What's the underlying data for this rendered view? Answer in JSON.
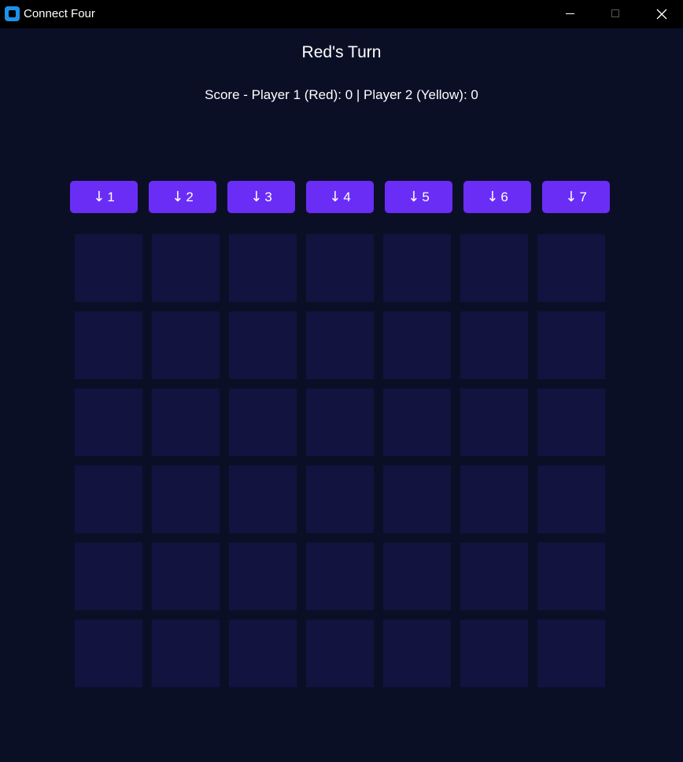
{
  "window": {
    "title": "Connect Four",
    "icon": "app-icon",
    "controls": [
      "minimize-icon",
      "maximize-icon",
      "close-icon"
    ]
  },
  "game": {
    "turn_text": "Red's Turn",
    "score_text": "Score - Player 1 (Red): 0 | Player 2 (Yellow): 0"
  },
  "columns": [
    {
      "arrow": "↓",
      "label": "1"
    },
    {
      "arrow": "↓",
      "label": "2"
    },
    {
      "arrow": "↓",
      "label": "3"
    },
    {
      "arrow": "↓",
      "label": "4"
    },
    {
      "arrow": "↓",
      "label": "5"
    },
    {
      "arrow": "↓",
      "label": "6"
    },
    {
      "arrow": "↓",
      "label": "7"
    }
  ],
  "board": {
    "rows": 6,
    "cols": 7,
    "cells": [
      [
        "empty",
        "empty",
        "empty",
        "empty",
        "empty",
        "empty",
        "empty"
      ],
      [
        "empty",
        "empty",
        "empty",
        "empty",
        "empty",
        "empty",
        "empty"
      ],
      [
        "empty",
        "empty",
        "empty",
        "empty",
        "empty",
        "empty",
        "empty"
      ],
      [
        "empty",
        "empty",
        "empty",
        "empty",
        "empty",
        "empty",
        "empty"
      ],
      [
        "empty",
        "empty",
        "empty",
        "empty",
        "empty",
        "empty",
        "empty"
      ],
      [
        "empty",
        "empty",
        "empty",
        "empty",
        "empty",
        "empty",
        "empty"
      ]
    ]
  },
  "colors": {
    "background": "#0b0f26",
    "button": "#6a2df6",
    "cell_empty": "#12133e",
    "titlebar": "#000000"
  }
}
